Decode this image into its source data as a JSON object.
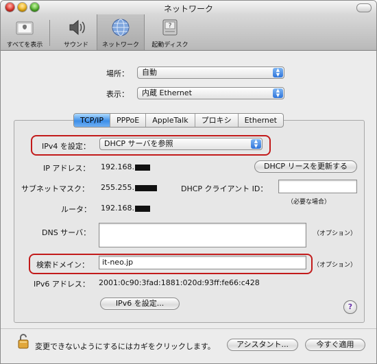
{
  "window": {
    "title": "ネットワーク"
  },
  "toolbar": {
    "items": [
      {
        "label": "すべてを表示"
      },
      {
        "label": "サウンド"
      },
      {
        "label": "ネットワーク"
      },
      {
        "label": "起動ディスク"
      }
    ],
    "selected": "ネットワーク"
  },
  "location": {
    "label": "場所：",
    "value": "自動"
  },
  "show": {
    "label": "表示：",
    "value": "内蔵 Ethernet"
  },
  "tabs": [
    "TCP/IP",
    "PPPoE",
    "AppleTalk",
    "プロキシ",
    "Ethernet"
  ],
  "active_tab": "TCP/IP",
  "ipv4": {
    "label": "IPv4 を設定：",
    "value": "DHCP サーバを参照"
  },
  "ip": {
    "label": "IP アドレス：",
    "value": "192.168."
  },
  "renew_button": "DHCP リースを更新する",
  "subnet": {
    "label": "サブネットマスク：",
    "value": "255.255."
  },
  "client_id": {
    "label": "DHCP クライアント ID：",
    "value": "",
    "hint": "（必要な場合）"
  },
  "router": {
    "label": "ルータ：",
    "value": "192.168."
  },
  "dns": {
    "label": "DNS サーバ：",
    "value": "",
    "hint": "（オプション）"
  },
  "search": {
    "label": "検索ドメイン：",
    "value": "it-neo.jp",
    "hint": "（オプション）"
  },
  "ipv6_address": {
    "label": "IPv6 アドレス：",
    "value": "2001:0c90:3fad:1881:020d:93ff:fe66:c428"
  },
  "ipv6_button": "IPv6 を設定...",
  "help": "?",
  "lock_text": "変更できないようにするにはカギをクリックします。",
  "assistant_button": "アシスタント...",
  "apply_button": "今すぐ適用",
  "colors": {
    "highlight": "#c21a1a",
    "tab_active": "#3d8ee8"
  }
}
